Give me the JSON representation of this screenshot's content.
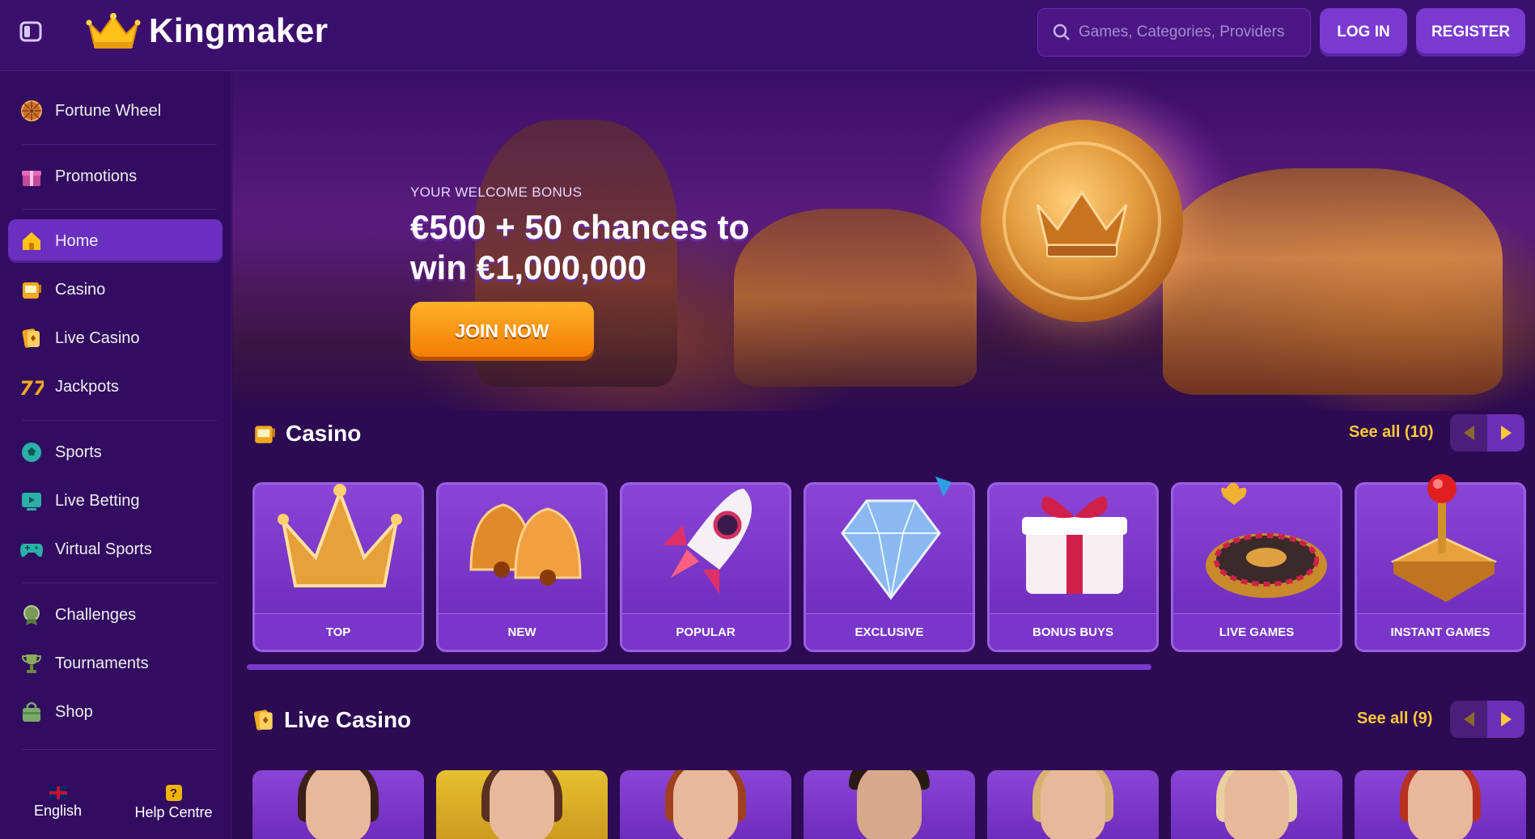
{
  "header": {
    "brand": "Kingmaker",
    "search_placeholder": "Games, Categories, Providers",
    "login_label": "LOG IN",
    "register_label": "REGISTER"
  },
  "sidebar": {
    "items": [
      {
        "label": "Fortune Wheel",
        "icon": "fortune-wheel-icon"
      },
      {
        "label": "Promotions",
        "icon": "gift-icon"
      },
      {
        "label": "Home",
        "icon": "home-icon",
        "active": true
      },
      {
        "label": "Casino",
        "icon": "slot-machine-icon"
      },
      {
        "label": "Live Casino",
        "icon": "cards-icon"
      },
      {
        "label": "Jackpots",
        "icon": "seven-seven-icon"
      },
      {
        "label": "Sports",
        "icon": "soccer-ball-icon"
      },
      {
        "label": "Live Betting",
        "icon": "play-screen-icon"
      },
      {
        "label": "Virtual Sports",
        "icon": "gamepad-icon"
      },
      {
        "label": "Challenges",
        "icon": "medal-icon"
      },
      {
        "label": "Tournaments",
        "icon": "trophy-icon"
      },
      {
        "label": "Shop",
        "icon": "shopping-bag-icon"
      }
    ],
    "language_label": "English",
    "help_label": "Help Centre"
  },
  "hero": {
    "subtitle": "YOUR WELCOME BONUS",
    "title": "€500 + 50 chances to win €1,000,000",
    "cta_label": "JOIN NOW"
  },
  "casino_section": {
    "title": "Casino",
    "see_all": "See all (10)",
    "cards": [
      {
        "label": "TOP",
        "icon": "crown-icon"
      },
      {
        "label": "NEW",
        "icon": "bells-icon"
      },
      {
        "label": "POPULAR",
        "icon": "rocket-icon"
      },
      {
        "label": "EXCLUSIVE",
        "icon": "diamond-icon"
      },
      {
        "label": "BONUS BUYS",
        "icon": "gift-box-icon"
      },
      {
        "label": "LIVE GAMES",
        "icon": "roulette-icon"
      },
      {
        "label": "INSTANT GAMES",
        "icon": "joystick-icon"
      }
    ]
  },
  "live_section": {
    "title": "Live Casino",
    "see_all": "See all (9)"
  },
  "colors": {
    "accent_yellow": "#ffc83a",
    "button_purple": "#7a3ad0",
    "cta_orange": "#f07a00",
    "background": "#2a0a4f"
  }
}
